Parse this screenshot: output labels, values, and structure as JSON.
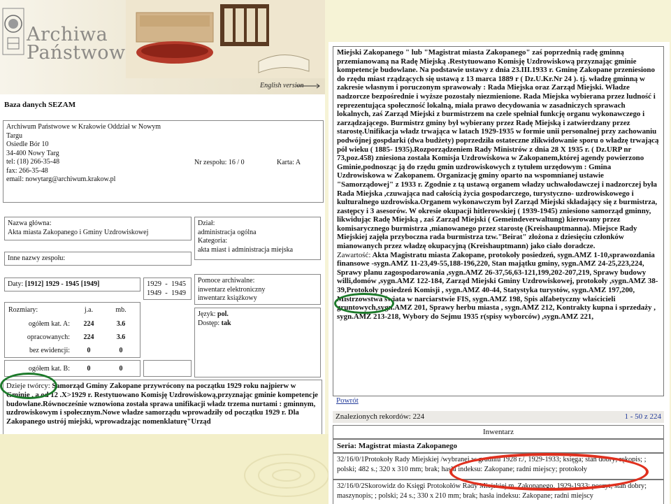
{
  "header": {
    "brand_line1": "Archiwa",
    "brand_line2": "Państwowe",
    "english_link": "English version"
  },
  "db_title": "Baza danych SEZAM",
  "archive": {
    "line1": "Archiwum Państwowe w Krakowie Oddział w Nowym",
    "line2": "Targu",
    "line3": "Osiedle Bór 10",
    "line4": "34-400 Nowy Targ",
    "line5": "tel: (18) 266-35-48",
    "line6": "fax: 266-35-48",
    "line7": "email: nowytarg@archiwum.krakow.pl",
    "fond_no": "Nr zespołu: 16 / 0",
    "card": "Karta: A"
  },
  "main_name": {
    "label": "Nazwa główna:",
    "value": "Akta miasta Zakopanego i Gminy Uzdrowiskowej"
  },
  "division": {
    "label": "Dział:",
    "value": "administracja ogólna",
    "category_label": "Kategoria:",
    "category_value": "akta miast i administracja miejska"
  },
  "other_names": {
    "label": "Inne nazwy zespołu:"
  },
  "dates": {
    "label": "Daty:",
    "value": "[1912] 1929 - 1945 [1949]",
    "range1": "1929  -  1945",
    "range2": "1949  -  1949"
  },
  "aids": {
    "label": "Pomoce archiwalne:",
    "line1": "inwentarz elektroniczny",
    "line2": "inwentarz książkowy"
  },
  "language": {
    "lang_label": "Język:",
    "lang_value": "pol.",
    "access_label": "Dostęp:",
    "access_value": "tak"
  },
  "sizes": {
    "label": "Rozmiary:",
    "col1": "j.a.",
    "col2": "mb.",
    "row1_label": "ogółem kat. A:",
    "row1_ja": "224",
    "row1_mb": "3.6",
    "row2_label": "opracowanych:",
    "row2_ja": "224",
    "row2_mb": "3.6",
    "row3_label": "bez ewidencji:",
    "row3_ja": "0",
    "row3_mb": "0",
    "row4_label": "ogółem kat. B:",
    "row4_ja": "0",
    "row4_mb": "0"
  },
  "history": {
    "label": "Dzieje twórcy:",
    "text": "Samorząd Gminy Zakopane przywrócony na początku 1929 roku najpierw w Gminie , a od 12 .X>1929 r. Restytuowano Komisję Uzdrowiskową,przyznając gminie kompetencje budowlane.Równocześnie wznowiona została sprawa unifikacji władz trzema nurtami : gminnym, uzdrowiskowym i społecznym.Nowe władze samorządu wprowadziły od początku 1929 r. Dla Zakopanego ustrój miejski, wprowadzając nomenklaturę\"Urząd"
  },
  "description": {
    "text": "Miejski Zakopanego \" lub \"Magistrat miasta Zakopanego\" zaś poprzednią radę gminną przemianowaną na Radę Miejską .Restytuowano Komisję Uzdrowiskową przyznając gminie kompetencje budowlane. Na podstawie ustawy z dnia 23.III.1933 r. Gminę Zakopane przeniesiono do rzędu miast rządzących się ustawą z 13 marca 1889 r ( Dz.U.Kr.Nr 24 ). tj. władzę gminną w zakresie własnym i poruczonym sprawowały : Rada Miejska oraz Zarząd Miejski. Władze nadzorcze bezpośrednie i wyższe pozostały niezmienione. Rada Miejska wybierana przez ludność i reprezentująca społeczność lokalną, miała prawo decydowania w zasadniczych sprawach lokalnych, zaś Zarząd Miejski z burmistrzem na czele spełniał funkcję organu wykonawczego i zarządzającego. Burmistrz gminy był wybierany przez Radę Miejską i zatwierdzany przez starostę.Unifikacja władz trwająca w latach 1929-1935 w formie unii personalnej przy zachowaniu podwójnej gospdarki (dwa budżety) poprzedziła ostateczne zlikwidowanie sporu o władzę trwającą pół wieku ( 1885- 1935).Rozporządzeniem Rady Ministrów z dnia 28 X 1935 r. ( Dz.URP nr 73,poz.458) zniesiona została Komisja Uzdrowiskowa w Zakopanem,której agendy powierzono Gminie,podnosząc ją do rzędu gmin uzdrowiskowych z tytułem urzędowym : Gmina Uzdrowiskowa w Zakopanem. Organizację gminy oparto na wspomnianej ustawie \"Samorządowej\" z 1933 r. Zgodnie z tą ustawą organem władzy uchwałodawczej i nadzorczej była Rada Miejska ,czuwająca nad całością życia gospodarczego, turystyczno- uzdrowiskowego i kulturalnego uzdrowiska.Organem wykonawczym był Zarząd Miejski składający się z burmistrza, zastępcy i 3 asesorów. W okresie okupacji hitlerowskiej ( 1939-1945) zniesiono samorząd gminny, likwidując Radę Miejską , zaś Zarząd Miejski ( Gemeindeverwaltung) kierowany przez komisarycznego burmistrza ,mianowanego przez starostę (Kreishauptmanna). Miejsce Rady Miejskiej zajęła przyboczna rada burmistrza tzw.\"Beirat\" złożona z dziesięciu członków mianowanych przez władzę okupacyjną (Kreishauptmann) jako ciało doradcze.",
    "contents_label": "Zawartość:",
    "contents_text": "Akta Magistratu miasta Zakopane, protokoły posiedzeń, sygn.AMZ 1-10,sprawozdania finansowe -sygn.AMZ 11-23,49-55,188-196,220, Stan majątku gminy, sygn.AMZ 24-25,223,224, Sprawy planu zagospodarowania ,sygn.AMZ 26-37,56,63-121,199,202-207,219, Sprawy budowy willi,domów ,sygn.AMZ 122-184, Zarząd Miejski Gminy Uzdrowiskowej, protokoły ,sygn.AMZ 38-39,Protokoły posiedzeń Komisji , sygn.AMZ 40-44, Statystyka turystów, sygn.AMZ 197,200, Mistrzowstwa świata w narciarstwie FIS, sygn.AMZ 198, Spis alfabetyczny właścicieli gruntowych,sygn.AMZ 201, Sprawy herbu miasta , sygn.AMZ 212, Kontrakty kupna i sprzedaży , sygn.AMZ 213-218, Wybory do Sejmu 1935 r(spisy wyborców) ,sygn.AMZ 221,"
  },
  "back_link": "Powrót",
  "records": {
    "label": "Znalezionych rekordów: 224",
    "pages": "1 - 50 z 224"
  },
  "inventory": {
    "header": "Inwentarz",
    "series": "Seria: Magistrat miasta Zakopanego",
    "item1": "32/16/0/1Protokoły Rady Miejskiej /wybranej w grudniu 1928 r./, 1929-1933; księga; stan dobry; rękopis; ; polski; 482 s.; 320 x 310 mm; brak; hasła indeksu: Zakopane; radni miejscy; protokoły",
    "item2": "32/16/0/2Skorowidz do Księgi Protokołów Rady Miejskiej m. Zakopanego, 1929-1933; poszyt; stan dobry; maszynopis; ; polski; 24 s.; 330 x 210 mm; brak; hasła indeksu: Zakopane; radni miejscy"
  },
  "colors": {
    "highlight_green": "#1c7a2a",
    "highlight_red": "#e0301e",
    "link_blue": "#223a9a",
    "slide_background": "#f6f3d6"
  }
}
